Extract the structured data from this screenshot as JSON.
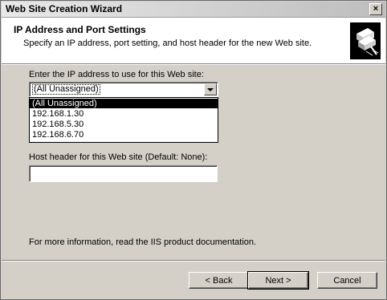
{
  "window": {
    "title": "Web Site Creation Wizard",
    "close_glyph": "×"
  },
  "header": {
    "title": "IP Address and Port Settings",
    "subtitle": "Specify an IP address, port setting, and host header for the new Web site.",
    "icon": "wizard-document-icon"
  },
  "ip_address": {
    "label": "Enter the IP address to use for this Web site:",
    "selected": "(All Unassigned)",
    "options": [
      "(All Unassigned)",
      "192.168.1.30",
      "192.168.5.30",
      "192.168.6.70"
    ]
  },
  "host_header": {
    "label": "Host header for this Web site (Default: None):",
    "value": ""
  },
  "info_text": "For more information, read the IIS product documentation.",
  "buttons": {
    "back": "< Back",
    "next": "Next >",
    "cancel": "Cancel"
  }
}
